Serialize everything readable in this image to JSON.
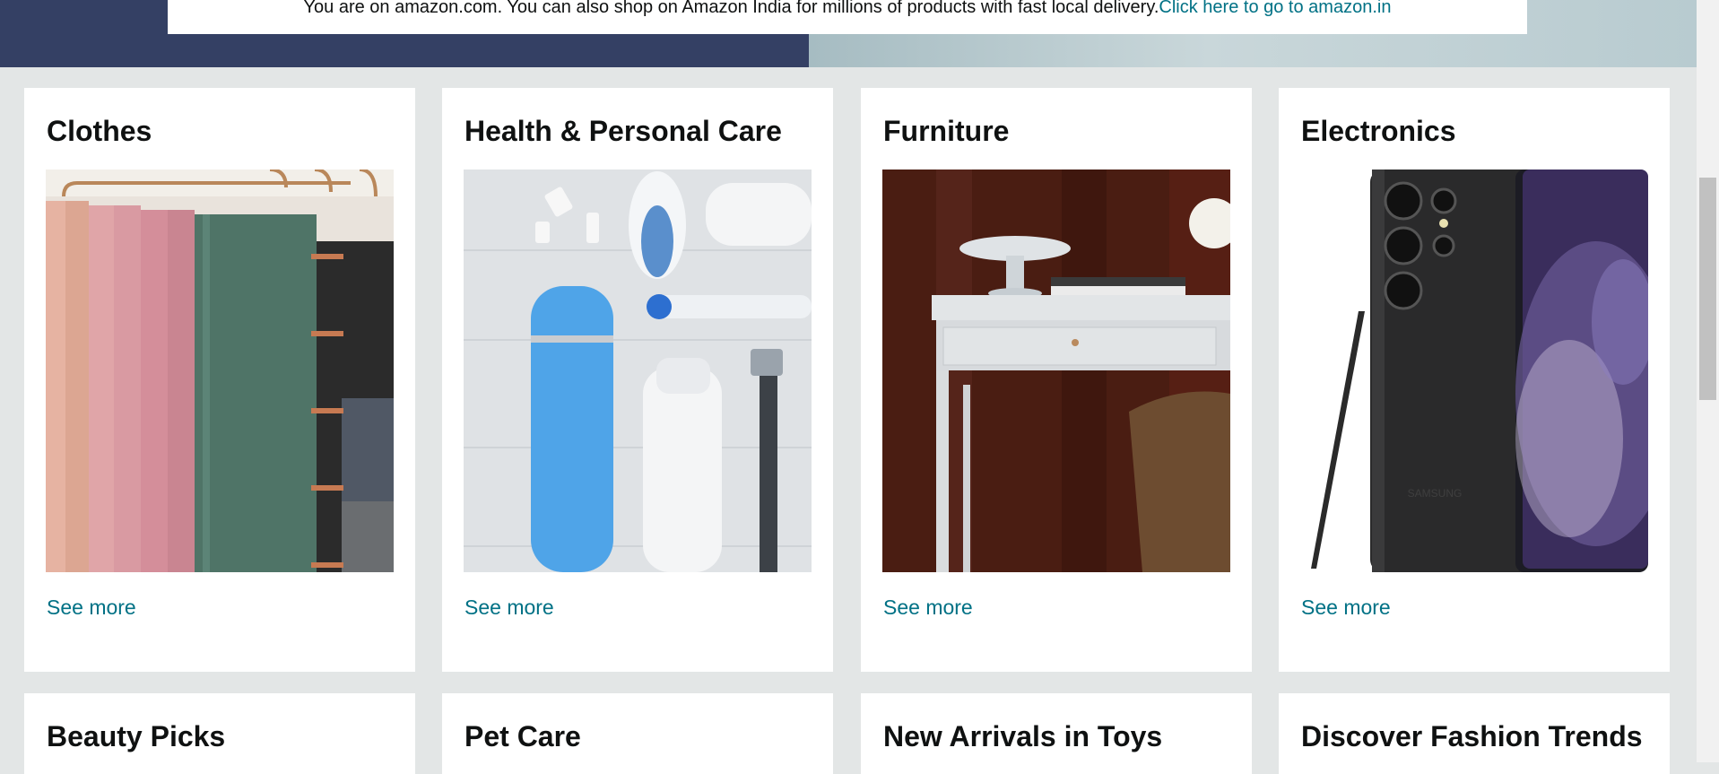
{
  "notice": {
    "text": "You are on amazon.com. You can also shop on Amazon India for millions of products with fast local delivery.",
    "link": "Click here to go to amazon.in"
  },
  "cards": [
    {
      "title": "Clothes",
      "image": "clothes-rack-photo",
      "link": "See more"
    },
    {
      "title": "Health & Personal Care",
      "image": "personal-care-products-photo",
      "link": "See more"
    },
    {
      "title": "Furniture",
      "image": "white-desk-photo",
      "link": "See more"
    },
    {
      "title": "Electronics",
      "image": "samsung-phone-photo",
      "link": "See more"
    }
  ],
  "cards_row2": [
    {
      "title": "Beauty Picks"
    },
    {
      "title": "Pet Care"
    },
    {
      "title": "New Arrivals in Toys"
    },
    {
      "title": "Discover Fashion Trends"
    }
  ]
}
